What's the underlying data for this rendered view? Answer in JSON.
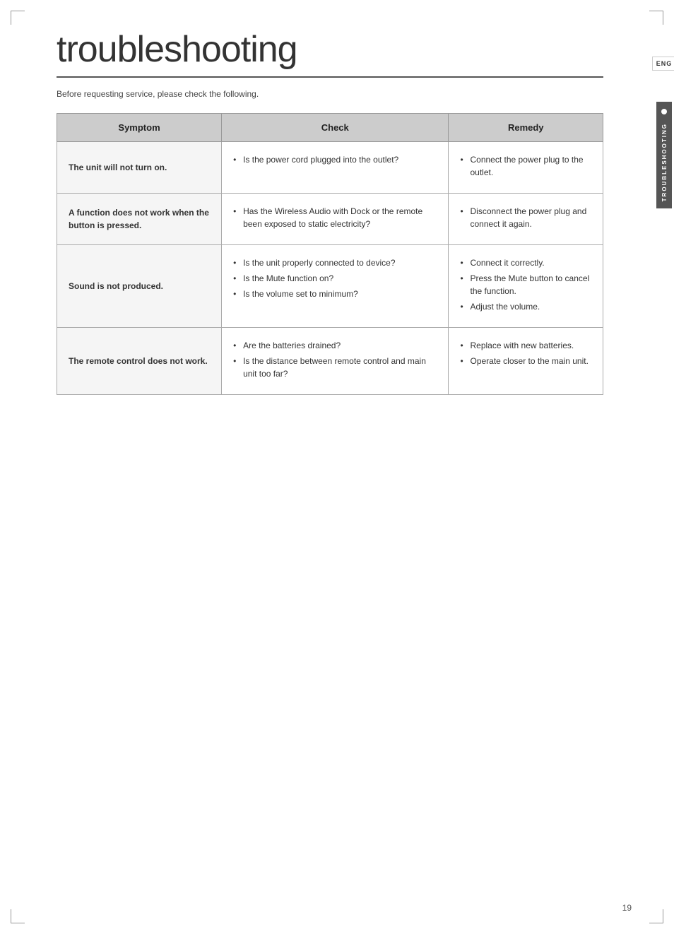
{
  "page": {
    "title": "troubleshooting",
    "subtitle": "Before requesting service, please check the following.",
    "page_number": "19",
    "side_eng": "ENG",
    "side_label": "TROUBLESHOOTING"
  },
  "table": {
    "headers": [
      "Symptom",
      "Check",
      "Remedy"
    ],
    "rows": [
      {
        "symptom": "The unit will not turn on.",
        "check_items": [
          "Is the power cord plugged into the outlet?"
        ],
        "remedy_items": [
          "Connect the power plug to the outlet."
        ]
      },
      {
        "symptom": "A function does not work when the button is pressed.",
        "check_items": [
          "Has the Wireless Audio with Dock or the remote been exposed to static electricity?"
        ],
        "remedy_items": [
          "Disconnect the power plug and connect it again."
        ]
      },
      {
        "symptom": "Sound is not produced.",
        "check_items": [
          "Is the unit properly connected to device?",
          "Is the Mute function on?",
          "Is the volume set to minimum?"
        ],
        "remedy_items": [
          "Connect it correctly.",
          "Press the Mute button to cancel the function.",
          "Adjust the volume."
        ]
      },
      {
        "symptom": "The remote control does not work.",
        "check_items": [
          "Are the batteries drained?",
          "Is the distance between remote control and main unit too far?"
        ],
        "remedy_items": [
          "Replace with new batteries.",
          "Operate closer to the main unit."
        ]
      }
    ]
  }
}
